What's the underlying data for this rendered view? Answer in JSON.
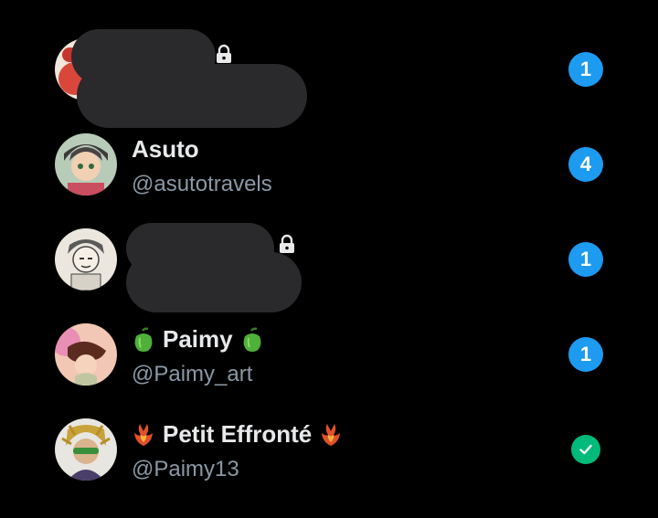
{
  "conversations": [
    {
      "name": "",
      "handle": "",
      "protected": true,
      "redacted": true,
      "unread_badge": "1",
      "avatar_icon": "user-avatar-icon"
    },
    {
      "name": "Asuto",
      "handle": "@asutotravels",
      "protected": false,
      "unread_badge": "4",
      "avatar_icon": "user-avatar-icon"
    },
    {
      "name": "",
      "handle": "",
      "protected": true,
      "redacted": true,
      "unread_badge": "1",
      "avatar_icon": "user-avatar-icon"
    },
    {
      "name": "Paimy",
      "handle": "@Paimy_art",
      "protected": false,
      "name_emoji": "green-pepper-emoji",
      "unread_badge": "1",
      "avatar_icon": "user-avatar-icon"
    },
    {
      "name": "Petit Effronté",
      "handle": "@Paimy13",
      "protected": false,
      "name_emoji": "phoenix-emoji",
      "status": "read-check-icon",
      "avatar_icon": "user-avatar-icon"
    }
  ],
  "colors": {
    "background": "#000000",
    "primary_text": "#e7e9ea",
    "secondary_text": "#8b98a5",
    "badge_blue": "#1d9bf0",
    "check_green": "#00ba7c",
    "redaction": "#2a2a2c"
  }
}
